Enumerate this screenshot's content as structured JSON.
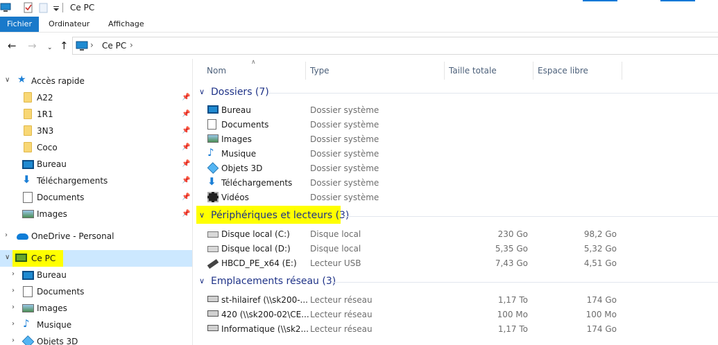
{
  "window": {
    "title": "Ce PC",
    "quick_access_icons": [
      "computer-icon",
      "properties-icon",
      "new-folder-icon",
      "customize-dropdown-icon"
    ]
  },
  "ribbon": {
    "tabs": [
      {
        "label": "Fichier",
        "active": true
      },
      {
        "label": "Ordinateur",
        "active": false
      },
      {
        "label": "Affichage",
        "active": false
      }
    ]
  },
  "address": {
    "breadcrumb": "Ce PC",
    "separator": "›"
  },
  "nav": {
    "quick_access": {
      "label": "Accès rapide",
      "items": [
        {
          "label": "A22",
          "icon": "folder-icon",
          "pinned": true
        },
        {
          "label": "1R1",
          "icon": "folder-icon",
          "pinned": true
        },
        {
          "label": "3N3",
          "icon": "folder-icon",
          "pinned": true
        },
        {
          "label": "Coco",
          "icon": "folder-icon",
          "pinned": true
        },
        {
          "label": "Bureau",
          "icon": "desktop-icon",
          "pinned": true
        },
        {
          "label": "Téléchargements",
          "icon": "download-icon",
          "pinned": true
        },
        {
          "label": "Documents",
          "icon": "documents-icon",
          "pinned": true
        },
        {
          "label": "Images",
          "icon": "pictures-icon",
          "pinned": true
        }
      ]
    },
    "onedrive": {
      "label": "OneDrive - Personal"
    },
    "this_pc": {
      "label": "Ce PC",
      "selected": true,
      "highlighted": true,
      "items": [
        {
          "label": "Bureau",
          "icon": "desktop-icon"
        },
        {
          "label": "Documents",
          "icon": "documents-icon"
        },
        {
          "label": "Images",
          "icon": "pictures-icon"
        },
        {
          "label": "Musique",
          "icon": "music-icon"
        },
        {
          "label": "Objets 3D",
          "icon": "3d-objects-icon"
        }
      ]
    }
  },
  "columns": {
    "name": "Nom",
    "type": "Type",
    "total": "Taille totale",
    "free": "Espace libre"
  },
  "groups": {
    "folders": {
      "title": "Dossiers (7)",
      "items": [
        {
          "name": "Bureau",
          "type": "Dossier système",
          "icon": "desktop-icon"
        },
        {
          "name": "Documents",
          "type": "Dossier système",
          "icon": "documents-icon"
        },
        {
          "name": "Images",
          "type": "Dossier système",
          "icon": "pictures-icon"
        },
        {
          "name": "Musique",
          "type": "Dossier système",
          "icon": "music-icon"
        },
        {
          "name": "Objets 3D",
          "type": "Dossier système",
          "icon": "3d-objects-icon"
        },
        {
          "name": "Téléchargements",
          "type": "Dossier système",
          "icon": "download-icon"
        },
        {
          "name": "Vidéos",
          "type": "Dossier système",
          "icon": "videos-icon"
        }
      ]
    },
    "devices": {
      "title": "Périphériques et lecteurs (3)",
      "highlighted": true,
      "items": [
        {
          "name": "Disque local (C:)",
          "type": "Disque local",
          "total": "230 Go",
          "free": "98,2 Go",
          "icon": "local-disk-icon"
        },
        {
          "name": "Disque local (D:)",
          "type": "Disque local",
          "total": "5,35 Go",
          "free": "5,32 Go",
          "icon": "local-disk-icon"
        },
        {
          "name": "HBCD_PE_x64 (E:)",
          "type": "Lecteur USB",
          "total": "7,43 Go",
          "free": "4,51 Go",
          "icon": "usb-drive-icon"
        }
      ]
    },
    "network": {
      "title": "Emplacements réseau (3)",
      "items": [
        {
          "name": "st-hilairef (\\\\sk200-...",
          "type": "Lecteur réseau",
          "total": "1,17 To",
          "free": "174 Go",
          "icon": "network-drive-icon"
        },
        {
          "name": "420 (\\\\sk200-02\\CE...",
          "type": "Lecteur réseau",
          "total": "100 Mo",
          "free": "100 Mo",
          "icon": "network-drive-icon"
        },
        {
          "name": "Informatique (\\\\sk2...",
          "type": "Lecteur réseau",
          "total": "1,17 To",
          "free": "174 Go",
          "icon": "network-drive-icon"
        }
      ]
    }
  },
  "colors": {
    "file_tab": "#1979ca",
    "group_title": "#1e3287",
    "selection": "#cce8ff",
    "highlight": "#ffff00"
  }
}
